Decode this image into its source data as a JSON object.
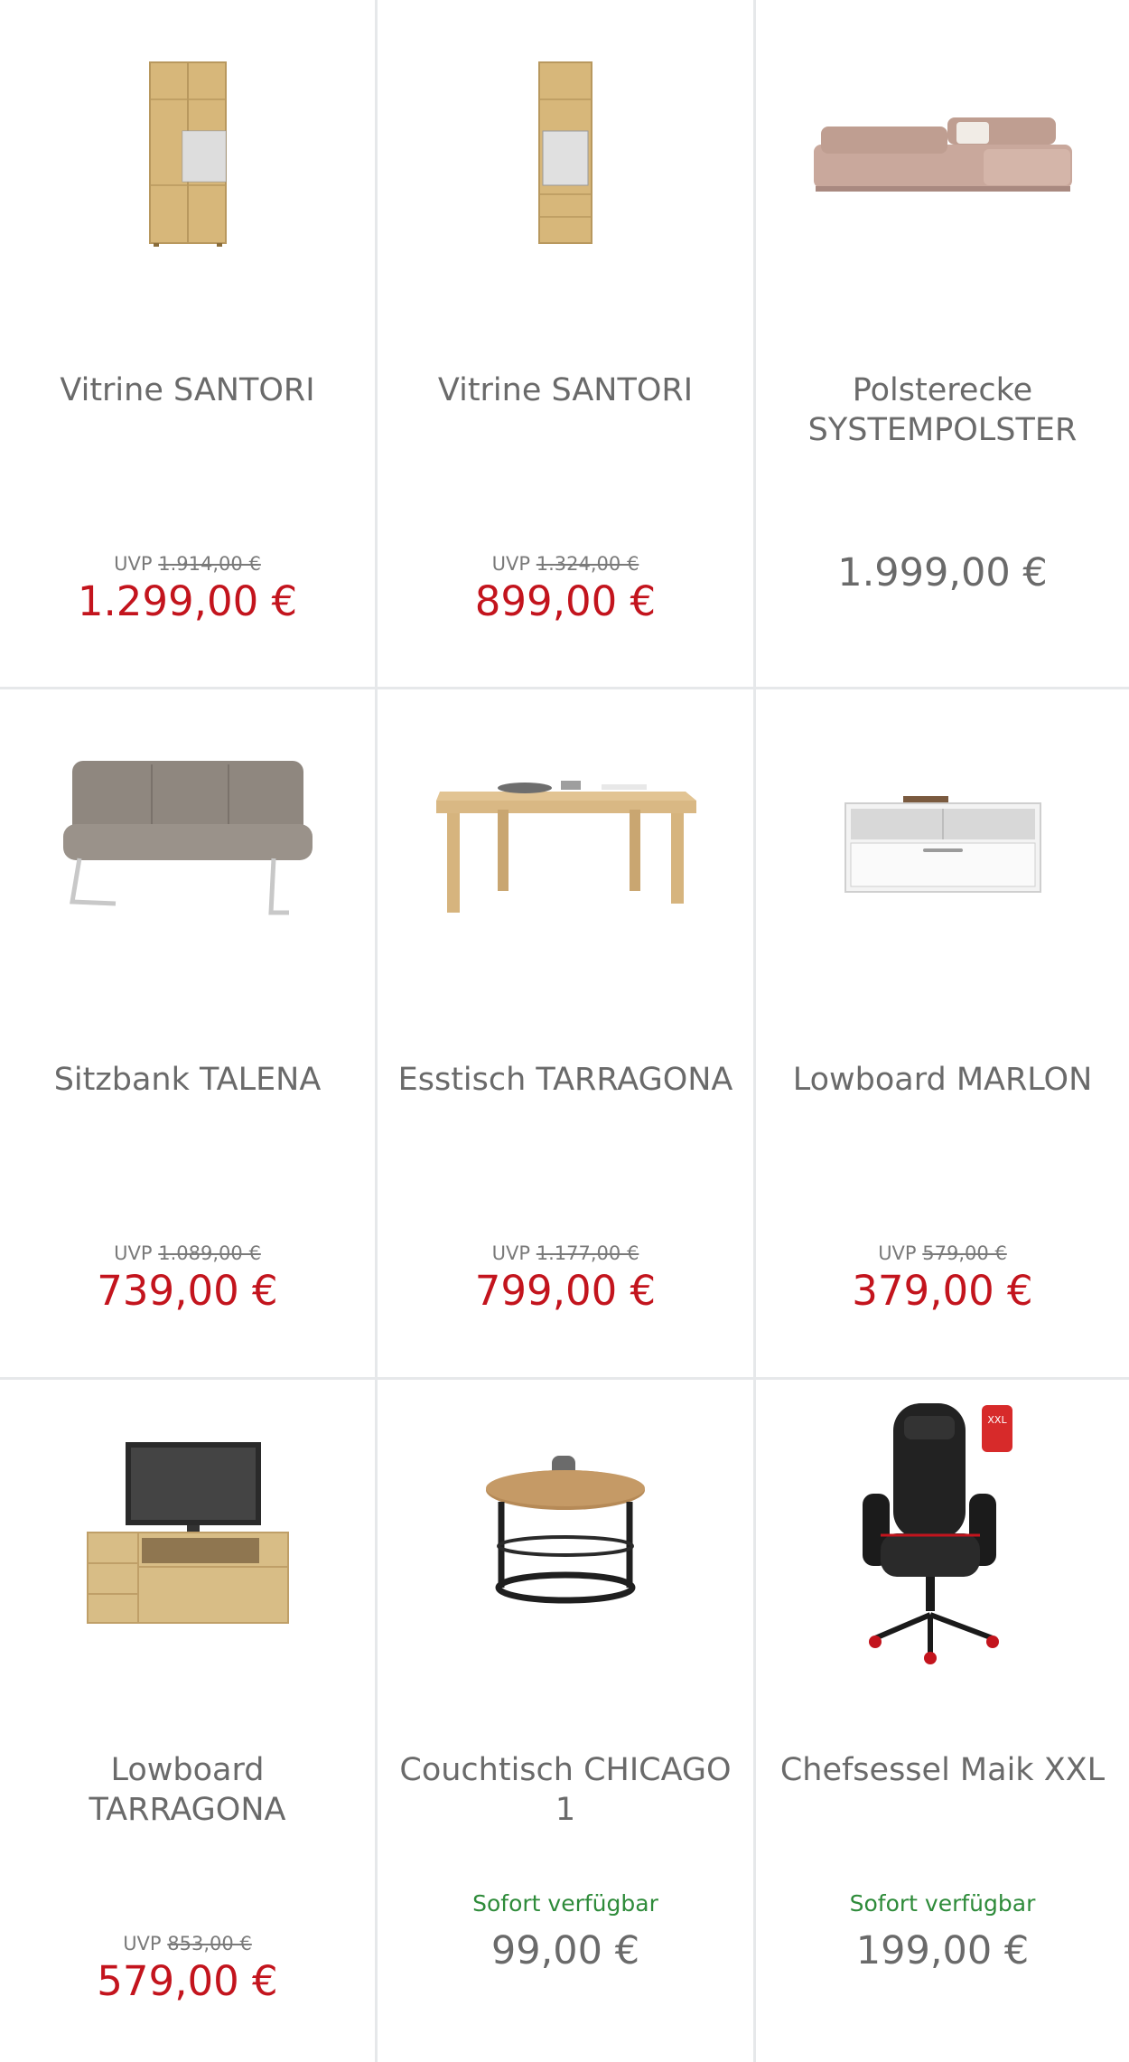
{
  "colors": {
    "sale_price": "#c3141d",
    "regular_price": "#6a6a6a",
    "availability": "#2e8b3a",
    "divider": "#e6e8ea"
  },
  "products": [
    {
      "title": "Vitrine SANTORI",
      "image_icon": "display-cabinet-image",
      "uvp_label": "UVP",
      "uvp_price": "1.914,00 €",
      "price": "1.299,00 €",
      "on_sale": true
    },
    {
      "title": "Vitrine SANTORI",
      "image_icon": "display-cabinet-image",
      "uvp_label": "UVP",
      "uvp_price": "1.324,00 €",
      "price": "899,00 €",
      "on_sale": true
    },
    {
      "title": "Polsterecke SYSTEMPOLSTER",
      "image_icon": "corner-sofa-image",
      "price": "1.999,00 €",
      "on_sale": false
    },
    {
      "title": "Sitzbank TALENA",
      "image_icon": "bench-image",
      "uvp_label": "UVP",
      "uvp_price": "1.089,00 €",
      "price": "739,00 €",
      "on_sale": true
    },
    {
      "title": "Esstisch TARRAGONA",
      "image_icon": "dining-table-image",
      "uvp_label": "UVP",
      "uvp_price": "1.177,00 €",
      "price": "799,00 €",
      "on_sale": true
    },
    {
      "title": "Lowboard MARLON",
      "image_icon": "white-lowboard-image",
      "uvp_label": "UVP",
      "uvp_price": "579,00 €",
      "price": "379,00 €",
      "on_sale": true
    },
    {
      "title": "Lowboard TARRAGONA",
      "image_icon": "tv-lowboard-image",
      "uvp_label": "UVP",
      "uvp_price": "853,00 €",
      "price": "579,00 €",
      "on_sale": true
    },
    {
      "title": "Couchtisch CHICAGO 1",
      "image_icon": "coffee-table-image",
      "availability": "Sofort verfügbar",
      "price": "99,00 €",
      "on_sale": false
    },
    {
      "title": "Chefsessel Maik XXL",
      "image_icon": "office-chair-image",
      "availability": "Sofort verfügbar",
      "price": "199,00 €",
      "on_sale": false,
      "badge": "XXL"
    }
  ]
}
